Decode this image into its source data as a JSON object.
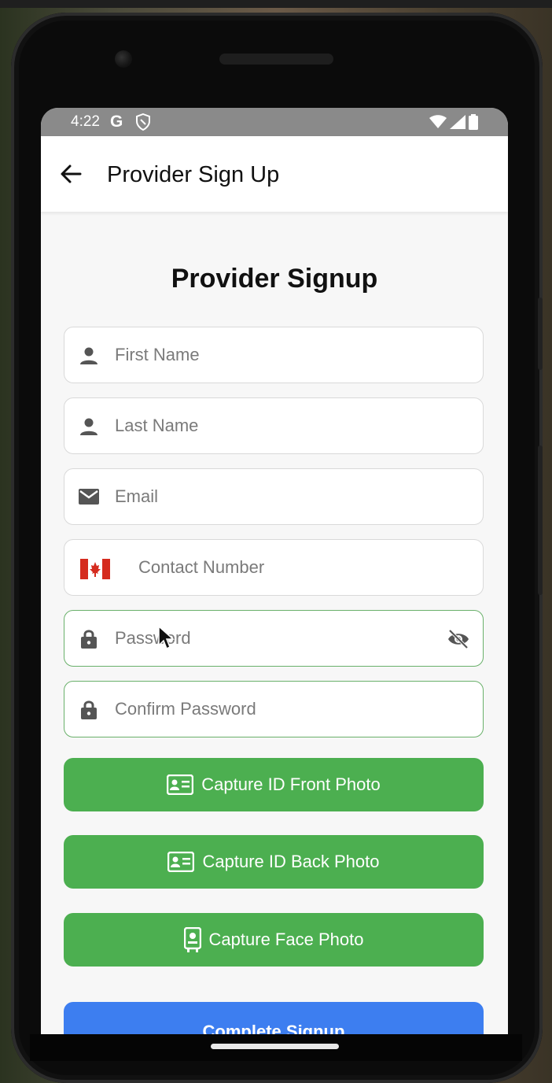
{
  "status_bar": {
    "time": "4:22",
    "google_glyph": "G",
    "icons": [
      "shield-icon",
      "wifi-icon",
      "signal-icon",
      "battery-icon"
    ]
  },
  "app_bar": {
    "title": "Provider Sign Up",
    "back_icon": "arrow-left-icon"
  },
  "form": {
    "title": "Provider Signup",
    "fields": {
      "first_name": {
        "placeholder": "First Name",
        "value": "",
        "icon": "person-icon"
      },
      "last_name": {
        "placeholder": "Last Name",
        "value": "",
        "icon": "person-icon"
      },
      "email": {
        "placeholder": "Email",
        "value": "",
        "icon": "mail-icon"
      },
      "contact": {
        "placeholder": "Contact Number",
        "value": "",
        "icon": "canada-flag-icon"
      },
      "password": {
        "placeholder": "Password",
        "value": "",
        "icon": "lock-icon",
        "toggle_icon": "eye-off-icon"
      },
      "confirm_password": {
        "placeholder": "Confirm Password",
        "value": "",
        "icon": "lock-icon"
      }
    },
    "buttons": {
      "id_front": {
        "label": "Capture ID Front Photo",
        "icon": "id-card-icon"
      },
      "id_back": {
        "label": "Capture ID Back Photo",
        "icon": "id-card-icon"
      },
      "face": {
        "label": "Capture Face Photo",
        "icon": "face-photo-icon"
      },
      "complete": {
        "label": "Complete Signup"
      }
    }
  },
  "colors": {
    "green_button": "#4caf50",
    "blue_button": "#3d7ef0",
    "focused_border": "#69b06a",
    "status_bar": "#8a8a8a"
  }
}
